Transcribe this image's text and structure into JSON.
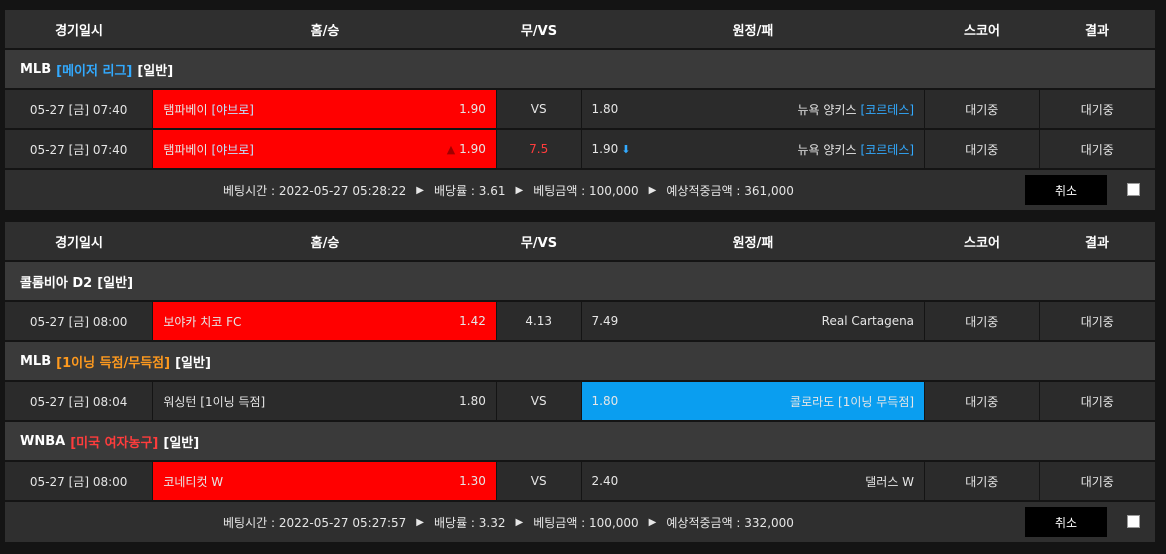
{
  "header": {
    "date": "경기일시",
    "home": "홈/승",
    "vs": "무/VS",
    "away": "원정/패",
    "score": "스코어",
    "result": "결과"
  },
  "slip1": {
    "league": {
      "name": "MLB",
      "sub": "[메이저 리그]",
      "tail": "[일반]",
      "sub_color": "#32aaff"
    },
    "rows": [
      {
        "date": "05-27 [금] 07:40",
        "home": "탬파베이",
        "home_sub": "[야브로]",
        "home_odd": "1.90",
        "vs": "VS",
        "away_odd": "1.80",
        "away": "뉴욕 양키스",
        "away_sub": "[코르테스]",
        "score": "대기중",
        "result": "대기중"
      },
      {
        "date": "05-27 [금] 07:40",
        "home": "탬파베이",
        "home_sub": "[야브로]",
        "home_odd": "1.90",
        "vs": "7.5",
        "away_odd": "1.90",
        "away": "뉴욕 양키스",
        "away_sub": "[코르테스]",
        "score": "대기중",
        "result": "대기중"
      }
    ],
    "bet": {
      "time_label": "베팅시간 : 2022-05-27 05:28:22",
      "rate_label": "배당률 : 3.61",
      "amount_label": "베팅금액 : 100,000",
      "win_label": "예상적중금액 : 361,000",
      "cancel": "취소"
    }
  },
  "slip2": {
    "groups": [
      {
        "league": {
          "name": "콜롬비아 D2",
          "sub": "",
          "tail": "[일반]",
          "sub_color": "#ffffff"
        },
        "row": {
          "date": "05-27 [금] 08:00",
          "home": "보야카 치코 FC",
          "home_odd": "1.42",
          "vs": "4.13",
          "away_odd": "7.49",
          "away": "Real Cartagena",
          "score": "대기중",
          "result": "대기중"
        }
      },
      {
        "league": {
          "name": "MLB",
          "sub": "[1이닝 득점/무득점]",
          "tail": "[일반]",
          "sub_color": "#ff9a1e"
        },
        "row": {
          "date": "05-27 [금] 08:04",
          "home": "워싱턴 [1이닝 득점]",
          "home_odd": "1.80",
          "vs": "VS",
          "away_odd": "1.80",
          "away": "콜로라도 [1이닝 무득점]",
          "score": "대기중",
          "result": "대기중"
        }
      },
      {
        "league": {
          "name": "WNBA",
          "sub": "[미국 여자농구]",
          "tail": "[일반]",
          "sub_color": "#ff3c3c"
        },
        "row": {
          "date": "05-27 [금] 08:00",
          "home": "코네티컷 W",
          "home_odd": "1.30",
          "vs": "VS",
          "away_odd": "2.40",
          "away": "댈러스 W",
          "score": "대기중",
          "result": "대기중"
        }
      }
    ],
    "bet": {
      "time_label": "베팅시간 : 2022-05-27 05:27:57",
      "rate_label": "배당률 : 3.32",
      "amount_label": "베팅금액 : 100,000",
      "win_label": "예상적중금액 : 332,000",
      "cancel": "취소"
    }
  },
  "colors": {
    "selected_red": "#ff0000",
    "selected_blue": "#0a9ef0",
    "mlb_sub": "#32aaff",
    "wnba_sub": "#ff3c3c",
    "inning_sub": "#ff9a1e"
  },
  "icons": {
    "bullet": "triangle-right-icon",
    "up": "arrow-up-icon",
    "down": "arrow-down-icon"
  }
}
